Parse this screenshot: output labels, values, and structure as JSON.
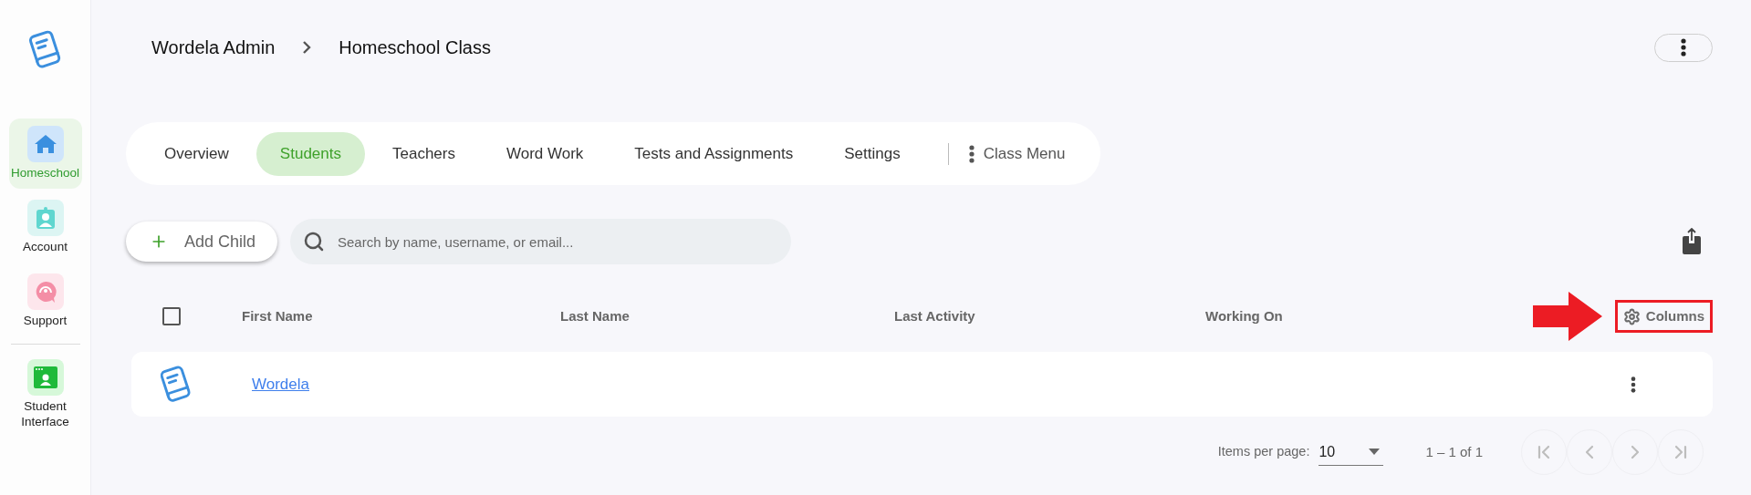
{
  "sidebar": {
    "items": [
      {
        "kind": "home",
        "label": "Homeschool",
        "selected": true
      },
      {
        "kind": "account",
        "label": "Account",
        "selected": false
      },
      {
        "kind": "support",
        "label": "Support",
        "selected": false
      }
    ],
    "bottom_items": [
      {
        "kind": "student",
        "label": "Student Interface",
        "selected": false
      }
    ]
  },
  "breadcrumb": [
    {
      "label": "Wordela Admin"
    },
    {
      "label": "Homeschool Class"
    }
  ],
  "tabs": [
    {
      "label": "Overview",
      "selected": false
    },
    {
      "label": "Students",
      "selected": true
    },
    {
      "label": "Teachers",
      "selected": false
    },
    {
      "label": "Word Work",
      "selected": false
    },
    {
      "label": "Tests and Assignments",
      "selected": false
    },
    {
      "label": "Settings",
      "selected": false
    }
  ],
  "class_menu": {
    "label": "Class Menu"
  },
  "add_button": {
    "label": "Add Child"
  },
  "search": {
    "placeholder": "Search by name, username, or email..."
  },
  "table": {
    "select_all": {
      "checked": false
    },
    "columns": [
      "First Name",
      "Last Name",
      "Last Activity",
      "Working On"
    ],
    "columns_button": {
      "label": "Columns",
      "highlighted": true
    },
    "rows": [
      {
        "first_name": "Wordela"
      }
    ]
  },
  "pagination": {
    "items_label": "Items per page:",
    "page_size": "10",
    "range": "1 – 1 of 1",
    "buttons": [
      {
        "kind": "first",
        "disabled": true
      },
      {
        "kind": "prev",
        "disabled": true
      },
      {
        "kind": "next",
        "disabled": true
      },
      {
        "kind": "last",
        "disabled": true
      }
    ]
  }
}
